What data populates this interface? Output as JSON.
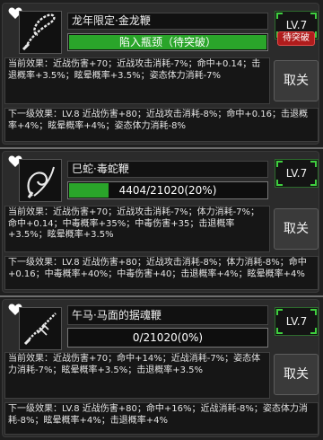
{
  "whips": [
    {
      "name": "龙年限定·金龙鞭",
      "bar_text": "陷入瓶颈（待突破）",
      "progress": 1.0,
      "level": "LV.7",
      "badge": "待突破",
      "current_effect": "当前效果：近战伤害+70；近战攻击消耗-7%；命中+0.14；击退概率+3.5%；眩晕概率+3.5%；姿态体力消耗-7%",
      "next_effect": "下一级效果：LV.8 近战伤害+80；近战攻击消耗-8%；命中+0.16；击退概率+4%；眩晕概率+4%；姿态体力消耗-8%",
      "action": "取关"
    },
    {
      "name": "巳蛇·毒蛇鞭",
      "bar_text": "4404/21020(20%)",
      "progress": 0.2,
      "level": "LV.7",
      "current_effect": "当前效果：近战伤害+70；近战攻击消耗-7%；体力消耗-7%；命中+0.14；中毒概率+35%；中毒伤害+35；击退概率+3.5%；眩晕概率+3.5%",
      "next_effect": "下一级效果：LV.8 近战伤害+80；近战攻击消耗-8%；体力消耗-8%；命中+0.16；中毒概率+40%；中毒伤害+40；击退概率+4%；眩晕概率+4%",
      "action": "取关"
    },
    {
      "name": "午马·马面的据魂鞭",
      "bar_text": "0/21020(0%)",
      "progress": 0.0,
      "level": "LV.7",
      "current_effect": "当前效果：近战伤害+70；命中+14%；近战消耗-7%；姿态体力消耗-7%；眩晕概率+3.5%；击退概率+3.5%",
      "next_effect": "下一级效果：LV.8 近战伤害+80；命中+16%；近战消耗-8%；姿态体力消耗-8%；眩晕概率+4%；击退概率+4%",
      "action": "取关"
    }
  ],
  "colors": {
    "progress": "#2aa52a",
    "badge": "#b01c1c",
    "level_corner": "#3fcf3f"
  },
  "icons": {
    "favorite": "heart-icon",
    "whip": "whip-icon"
  }
}
